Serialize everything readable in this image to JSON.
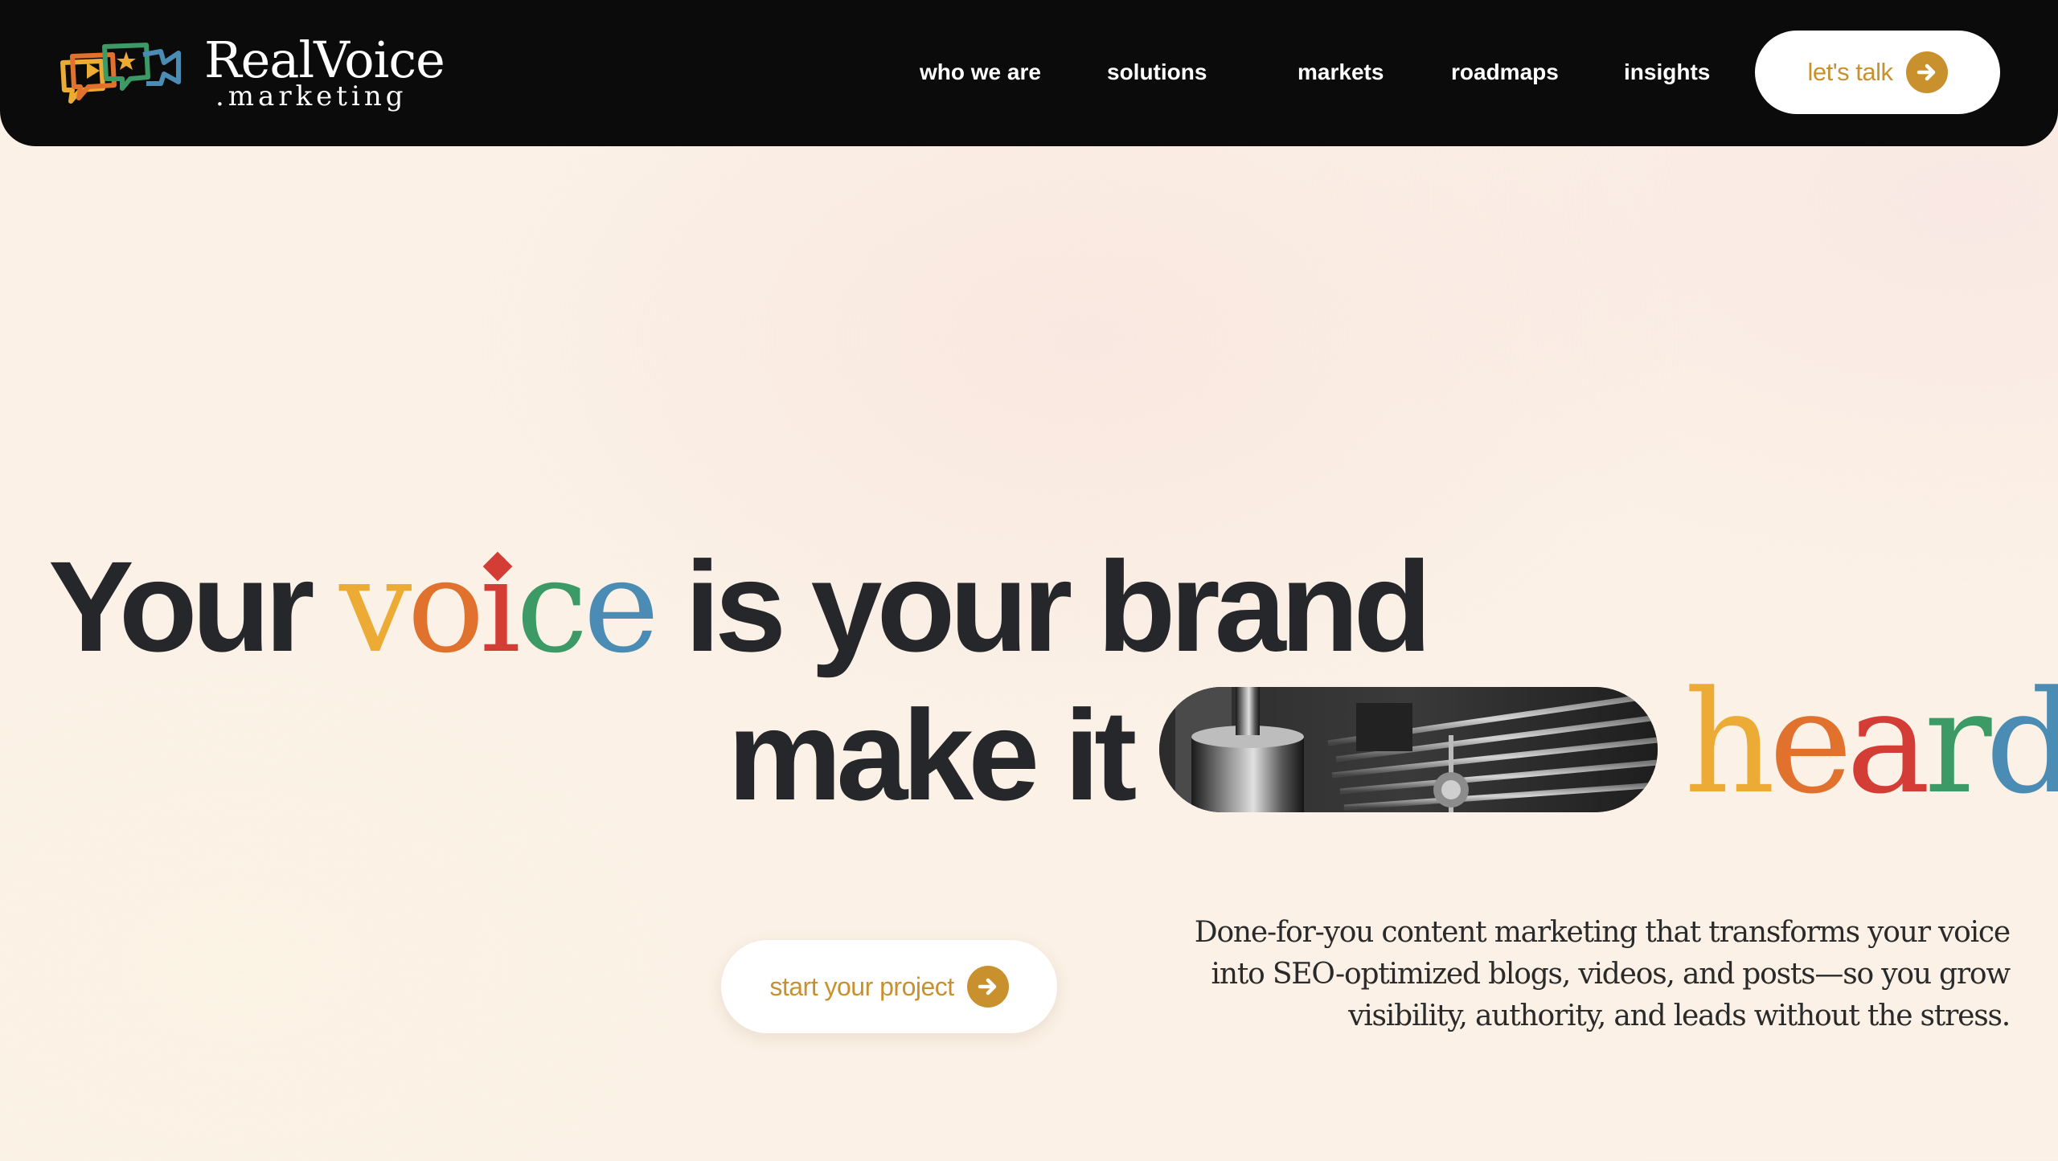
{
  "nav": {
    "brand_name": "RealVoice",
    "brand_suffix": ".marketing",
    "links": [
      "who we are",
      "solutions",
      "markets",
      "roadmaps",
      "insights"
    ],
    "cta_label": "let's talk"
  },
  "hero": {
    "line1_prefix": "Your",
    "line1_accent_letters": [
      "v",
      "o",
      "i",
      "c",
      "e"
    ],
    "line1_suffix": "is your brand",
    "line2_text": "make it",
    "line2_accent_letters": [
      "h",
      "e",
      "a",
      "r",
      "d"
    ],
    "cta_label": "start your project",
    "description": "Done-for-you content marketing that transforms your voice into SEO-optimized blogs, videos, and posts—so you grow visibility, authority, and leads without the stress."
  },
  "icons": {
    "logo": "speech-bubbles-logo-icon",
    "cta_arrow": "arrow-right-circle-icon"
  },
  "colors": {
    "nav_bg": "#0b0b0b",
    "accent_gold": "#c9912e",
    "yellow": "#ebab34",
    "orange": "#e0722e",
    "red": "#d43d35",
    "green": "#3b9a66",
    "blue": "#4b8cb4",
    "text_dark": "#25272b",
    "page_bg": "#fbf1e6"
  }
}
